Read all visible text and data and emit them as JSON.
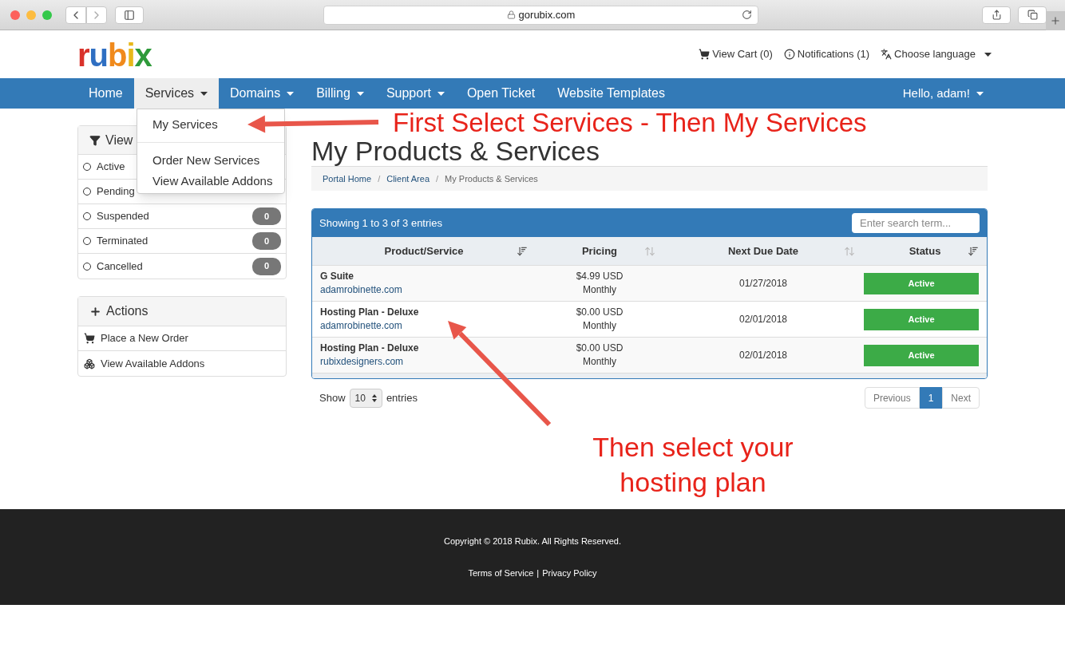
{
  "browser": {
    "url": "gorubix.com"
  },
  "header": {
    "logo": "rubix",
    "links": [
      {
        "kind": "cart",
        "label": "View Cart (0)"
      },
      {
        "kind": "info",
        "label": "Notifications (1)"
      },
      {
        "kind": "language",
        "label": "Choose language"
      }
    ]
  },
  "nav": {
    "items": [
      {
        "label": "Home",
        "dropdown": false,
        "selected": false
      },
      {
        "label": "Services",
        "dropdown": true,
        "selected": true
      },
      {
        "label": "Domains",
        "dropdown": true,
        "selected": false
      },
      {
        "label": "Billing",
        "dropdown": true,
        "selected": false
      },
      {
        "label": "Support",
        "dropdown": true,
        "selected": false
      },
      {
        "label": "Open Ticket",
        "dropdown": false,
        "selected": false
      },
      {
        "label": "Website Templates",
        "dropdown": false,
        "selected": false
      }
    ],
    "user": "Hello, adam!"
  },
  "services_menu": {
    "groups": [
      [
        "My Services"
      ],
      [
        "Order New Services",
        "View Available Addons"
      ]
    ]
  },
  "sidebar": {
    "view_panel": {
      "title": "View",
      "filters": [
        {
          "label": "Active"
        },
        {
          "label": "Pending"
        },
        {
          "label": "Suspended",
          "count": "0"
        },
        {
          "label": "Terminated",
          "count": "0"
        },
        {
          "label": "Cancelled",
          "count": "0"
        }
      ]
    },
    "actions_panel": {
      "title": "Actions",
      "items": [
        {
          "kind": "cart",
          "label": "Place a New Order"
        },
        {
          "kind": "addons",
          "label": "View Available Addons"
        }
      ]
    }
  },
  "page": {
    "title": "My Products & Services",
    "breadcrumb": [
      "Portal Home",
      "Client Area",
      "My Products & Services"
    ],
    "breadcrumb_separator": "/"
  },
  "table": {
    "summary": "Showing 1 to 3 of 3 entries",
    "search_placeholder": "Enter search term...",
    "columns": [
      {
        "label": "Product/Service",
        "sorted": true
      },
      {
        "label": "Pricing",
        "sorted": false
      },
      {
        "label": "Next Due Date",
        "sorted": false
      },
      {
        "label": "Status",
        "sorted": true
      }
    ],
    "rows": [
      {
        "product": "G Suite",
        "domain": "adamrobinette.com",
        "price": "$4.99 USD",
        "cycle": "Monthly",
        "due": "01/27/2018",
        "status": "Active"
      },
      {
        "product": "Hosting Plan - Deluxe",
        "domain": "adamrobinette.com",
        "price": "$0.00 USD",
        "cycle": "Monthly",
        "due": "02/01/2018",
        "status": "Active"
      },
      {
        "product": "Hosting Plan - Deluxe",
        "domain": "rubixdesigners.com",
        "price": "$0.00 USD",
        "cycle": "Monthly",
        "due": "02/01/2018",
        "status": "Active"
      }
    ],
    "length": {
      "before": "Show",
      "value": "10",
      "after": "entries"
    },
    "pagination": [
      {
        "label": "Previous",
        "selected": false
      },
      {
        "label": "1",
        "selected": true
      },
      {
        "label": "Next",
        "selected": false
      }
    ]
  },
  "annotations": [
    "First Select Services - Then My Services",
    "Then select your hosting plan"
  ],
  "footer": {
    "copyright": "Copyright © 2018 Rubix. All Rights Reserved.",
    "links": [
      "Terms of Service",
      "Privacy Policy"
    ],
    "separator": "|"
  }
}
